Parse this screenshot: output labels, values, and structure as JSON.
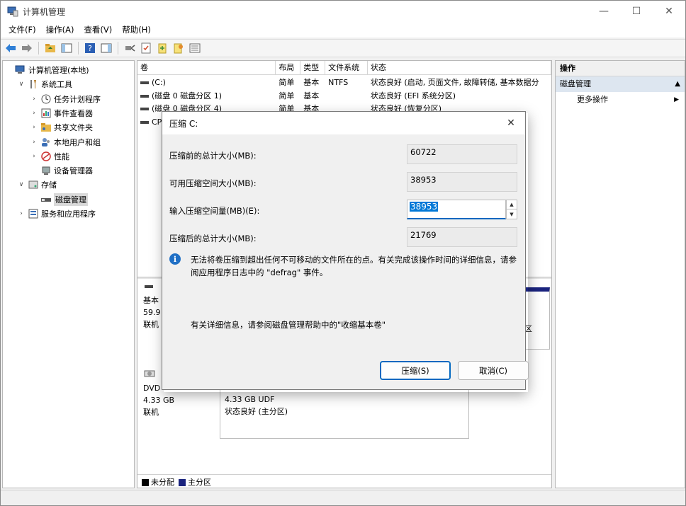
{
  "window": {
    "title": "计算机管理"
  },
  "menu": [
    "文件(F)",
    "操作(A)",
    "查看(V)",
    "帮助(H)"
  ],
  "tree": [
    {
      "label": "计算机管理(本地)",
      "indent": 0,
      "twisty": "",
      "icon": "computer-icon"
    },
    {
      "label": "系统工具",
      "indent": 1,
      "twisty": "∨",
      "icon": "tools-icon"
    },
    {
      "label": "任务计划程序",
      "indent": 2,
      "twisty": "›",
      "icon": "clock-icon"
    },
    {
      "label": "事件查看器",
      "indent": 2,
      "twisty": "›",
      "icon": "event-viewer-icon"
    },
    {
      "label": "共享文件夹",
      "indent": 2,
      "twisty": "›",
      "icon": "shared-folder-icon"
    },
    {
      "label": "本地用户和组",
      "indent": 2,
      "twisty": "›",
      "icon": "users-icon"
    },
    {
      "label": "性能",
      "indent": 2,
      "twisty": "›",
      "icon": "performance-icon"
    },
    {
      "label": "设备管理器",
      "indent": 2,
      "twisty": "",
      "icon": "device-manager-icon"
    },
    {
      "label": "存储",
      "indent": 1,
      "twisty": "∨",
      "icon": "storage-icon"
    },
    {
      "label": "磁盘管理",
      "indent": 2,
      "twisty": "",
      "icon": "disk-management-icon",
      "selected": true
    },
    {
      "label": "服务和应用程序",
      "indent": 1,
      "twisty": "›",
      "icon": "services-icon"
    }
  ],
  "volume_list": {
    "headers": [
      "卷",
      "布局",
      "类型",
      "文件系统",
      "状态"
    ],
    "rows": [
      {
        "vol": "(C:)",
        "layout": "简单",
        "type": "基本",
        "fs": "NTFS",
        "status": "状态良好 (启动, 页面文件, 故障转储, 基本数据分"
      },
      {
        "vol": "(磁盘 0 磁盘分区 1)",
        "layout": "简单",
        "type": "基本",
        "fs": "",
        "status": "状态良好 (EFI 系统分区)"
      },
      {
        "vol": "(磁盘 0 磁盘分区 4)",
        "layout": "简单",
        "type": "基本",
        "fs": "",
        "status": "状态良好 (恢复分区)"
      },
      {
        "vol": "CP",
        "layout": "",
        "type": "",
        "fs": "",
        "status": ""
      }
    ]
  },
  "disk0": {
    "line1": "基本",
    "line2": "59.9",
    "line3": "联机",
    "tail": "区"
  },
  "disk_dvd": {
    "label1": "DVD",
    "label2": "4.33 GB",
    "label3": "联机",
    "size": "4.33 GB UDF",
    "status": "状态良好 (主分区)"
  },
  "legend": {
    "unallocated": "未分配",
    "primary": "主分区"
  },
  "actions": {
    "title": "操作",
    "group": "磁盘管理",
    "more": "更多操作"
  },
  "dialog": {
    "title": "压缩 C:",
    "total_before_label": "压缩前的总计大小(MB):",
    "total_before_value": "60722",
    "available_label": "可用压缩空间大小(MB):",
    "available_value": "38953",
    "input_label": "输入压缩空间量(MB)(E):",
    "input_value": "38953",
    "total_after_label": "压缩后的总计大小(MB):",
    "total_after_value": "21769",
    "info": "无法将卷压缩到超出任何不可移动的文件所在的点。有关完成该操作时间的详细信息，请参阅应用程序日志中的 \"defrag\" 事件。",
    "help": "有关详细信息，请参阅磁盘管理帮助中的\"收缩基本卷\"",
    "shrink_button": "压缩(S)",
    "cancel_button": "取消(C)"
  },
  "colors": {
    "accent": "#0067c0",
    "primary_partition": "#1a237e",
    "unallocated": "#000000",
    "info_icon": "#1f6fc5"
  }
}
